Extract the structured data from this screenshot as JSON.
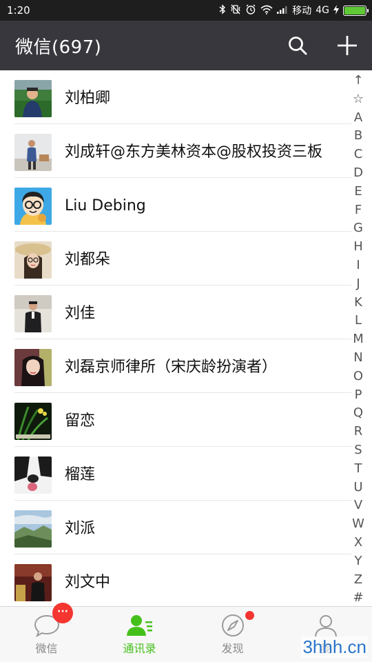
{
  "status_bar": {
    "time": "1:20",
    "carrier": "移动",
    "network": "4G",
    "icons": [
      "bluetooth-icon",
      "vibrate-icon",
      "alarm-icon",
      "wifi-icon",
      "signal-icon",
      "charging-icon",
      "battery-icon"
    ],
    "battery_level": 1.0
  },
  "header": {
    "title": "微信(697)",
    "actions": [
      "search-icon",
      "add-icon"
    ]
  },
  "contacts": [
    {
      "name": "刘柏卿"
    },
    {
      "name": "刘成轩@东方美林资本@股权投资三板"
    },
    {
      "name": "Liu Debing"
    },
    {
      "name": "刘都朵"
    },
    {
      "name": "刘佳"
    },
    {
      "name": "刘磊京师律所（宋庆龄扮演者）"
    },
    {
      "name": "留恋"
    },
    {
      "name": "榴莲"
    },
    {
      "name": "刘派"
    },
    {
      "name": "刘文中"
    }
  ],
  "index_bar": [
    "↑",
    "☆",
    "A",
    "B",
    "C",
    "D",
    "E",
    "F",
    "G",
    "H",
    "I",
    "J",
    "K",
    "L",
    "M",
    "N",
    "O",
    "P",
    "Q",
    "R",
    "S",
    "T",
    "U",
    "V",
    "W",
    "X",
    "Y",
    "Z",
    "#"
  ],
  "tabs": [
    {
      "label": "微信",
      "icon": "chat-icon",
      "badge": "···",
      "active": false
    },
    {
      "label": "通讯录",
      "icon": "contacts-icon",
      "active": true
    },
    {
      "label": "发现",
      "icon": "compass-icon",
      "dot": true,
      "active": false
    },
    {
      "label": "我",
      "icon": "person-icon",
      "active": false
    }
  ],
  "watermark": "3hhh.cn",
  "colors": {
    "accent": "#45c01a",
    "header_bg": "#37373d",
    "badge": "#f43530"
  }
}
